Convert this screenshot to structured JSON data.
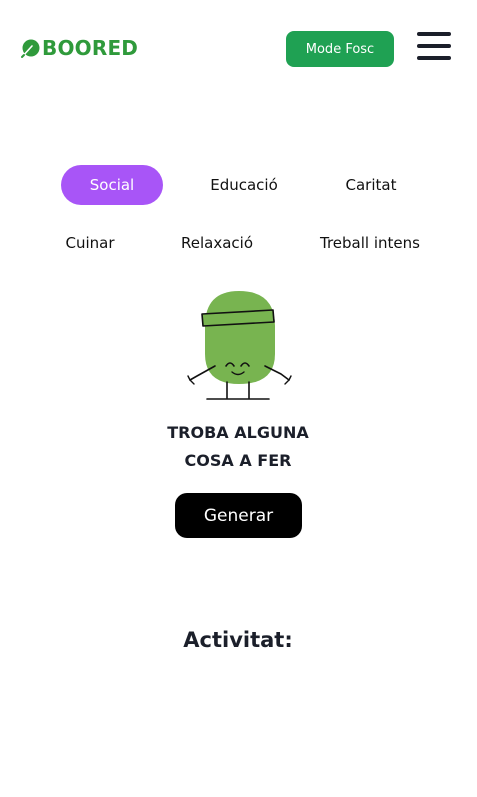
{
  "header": {
    "logo_text": "BOORED",
    "logo_icon": "leaf-icon",
    "dark_mode_label": "Mode Fosc",
    "menu_icon": "hamburger-menu-icon"
  },
  "categories": {
    "row1": [
      {
        "label": "Social",
        "active": true
      },
      {
        "label": "Educació",
        "active": false
      },
      {
        "label": "Caritat",
        "active": false
      }
    ],
    "row2": [
      {
        "label": "Cuinar",
        "active": false
      },
      {
        "label": "Relaxació",
        "active": false
      },
      {
        "label": "Treball intens",
        "active": false
      }
    ]
  },
  "hero": {
    "illustration": "green-mascot-illustration",
    "headline_line1": "TROBA ALGUNA",
    "headline_line2": "COSA A FER",
    "generate_label": "Generar"
  },
  "activity": {
    "title": "Activitat:"
  },
  "colors": {
    "brand_green": "#2f9a3b",
    "button_green": "#1fa153",
    "active_category": "#a855f7",
    "mascot_green": "#78b450",
    "text_dark": "#1b1f2a"
  }
}
